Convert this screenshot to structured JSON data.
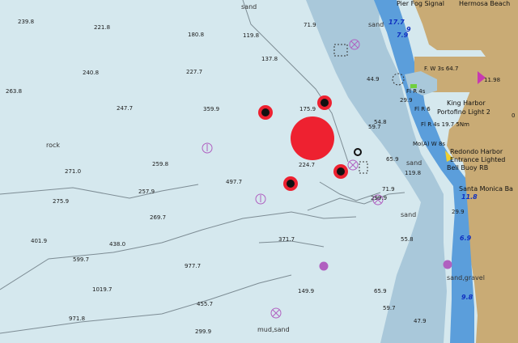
{
  "colors": {
    "deep_water": "#d5e8ee",
    "shallow_water": "#a9c8da",
    "channel": "#5b9edb",
    "land": "#c9ab75",
    "own_vessel": "#ee2130",
    "contour": "#7d8c94"
  },
  "place_names": [
    {
      "id": "pier-fog-signal",
      "text": "Pier Fog Signal"
    },
    {
      "id": "hermosa-beach",
      "text": "Hermosa Beach"
    },
    {
      "id": "king-harbor",
      "text": "King Harbor"
    },
    {
      "id": "portofino-light",
      "text": "Portofino Light 2"
    },
    {
      "id": "redondo-harbor-1",
      "text": "Redondo Harbor"
    },
    {
      "id": "redondo-harbor-2",
      "text": "Entrance Lighted"
    },
    {
      "id": "redondo-harbor-3",
      "text": "Bell Buoy RB"
    },
    {
      "id": "santa-monica",
      "text": "Santa Monica Ba"
    }
  ],
  "light_labels": [
    {
      "id": "fl-g-light",
      "text": "F. W 3s 64.7"
    },
    {
      "id": "fl-r-light",
      "text": "Fl R 4s"
    },
    {
      "id": "fl-r-2",
      "text": "Fl R 6"
    },
    {
      "id": "fl-r-3",
      "text": "Fl R 4s 19.7 5Nm"
    },
    {
      "id": "mo-a",
      "text": "Mo(A) W 8s"
    }
  ],
  "seabed_labels": [
    "sand",
    "sand",
    "rock",
    "sand",
    "sand",
    "mud,sand",
    "sand,gravel"
  ],
  "depths": [
    "239.8",
    "221.8",
    "180.8",
    "119.8",
    "71.9",
    "240.8",
    "227.7",
    "137.8",
    "44.9",
    "263.8",
    "247.7",
    "359.9",
    "175.9",
    "29.9",
    "54.8",
    "59.7",
    "259.8",
    "224.7",
    "65.9",
    "119.8",
    "271.0",
    "497.7",
    "71.9",
    "275.9",
    "257.9",
    "269.7",
    "299.9",
    "401.9",
    "438.0",
    "371.7",
    "55.8",
    "599.7",
    "977.7",
    "1019.7",
    "455.7",
    "149.9",
    "65.9",
    "971.8",
    "299.9",
    "59.7",
    "47.9",
    "11.98",
    "0"
  ],
  "blue_depths": [
    "17.7",
    "9",
    "7.9",
    "11.8",
    "29.9",
    "6.9",
    "9.8"
  ]
}
